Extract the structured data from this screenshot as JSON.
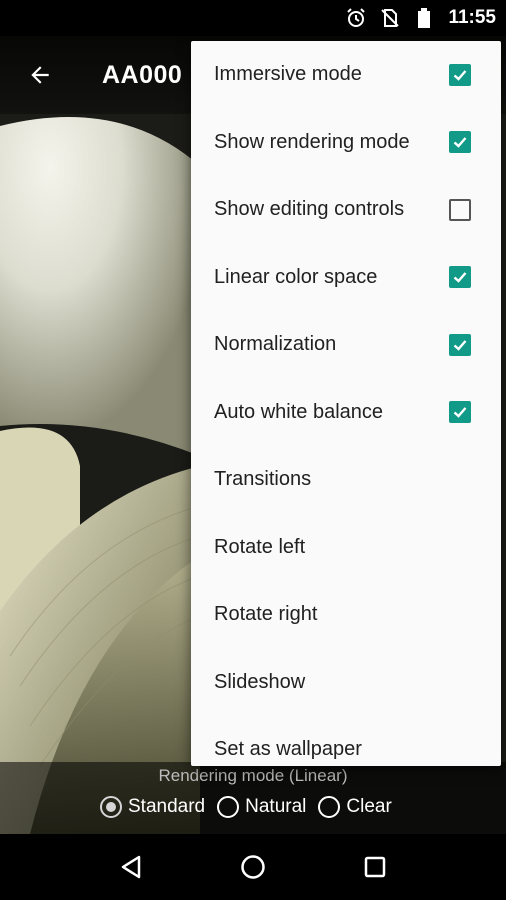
{
  "status_bar": {
    "time": "11:55",
    "icons": [
      "alarm-icon",
      "no-sim-icon",
      "battery-icon"
    ]
  },
  "app_bar": {
    "title": "AA000",
    "back_icon": "arrow-back-icon"
  },
  "menu": {
    "items": [
      {
        "label": "Immersive mode",
        "checkbox": true,
        "checked": true
      },
      {
        "label": "Show rendering mode",
        "checkbox": true,
        "checked": true
      },
      {
        "label": "Show editing controls",
        "checkbox": true,
        "checked": false
      },
      {
        "label": "Linear color space",
        "checkbox": true,
        "checked": true
      },
      {
        "label": "Normalization",
        "checkbox": true,
        "checked": true
      },
      {
        "label": "Auto white balance",
        "checkbox": true,
        "checked": true
      },
      {
        "label": "Transitions",
        "checkbox": false
      },
      {
        "label": "Rotate left",
        "checkbox": false
      },
      {
        "label": "Rotate right",
        "checkbox": false
      },
      {
        "label": "Slideshow",
        "checkbox": false
      },
      {
        "label": "Set as wallpaper",
        "checkbox": false
      }
    ]
  },
  "rendering": {
    "label": "Rendering mode (Linear)",
    "options": [
      {
        "label": "Standard",
        "selected": true
      },
      {
        "label": "Natural",
        "selected": false
      },
      {
        "label": "Clear",
        "selected": false
      }
    ]
  },
  "nav_bar": {
    "icons": [
      "back-triangle-icon",
      "home-circle-icon",
      "recents-square-icon"
    ]
  },
  "colors": {
    "accent": "#119a88",
    "menu_bg": "#fafafa",
    "menu_text": "#212121"
  }
}
